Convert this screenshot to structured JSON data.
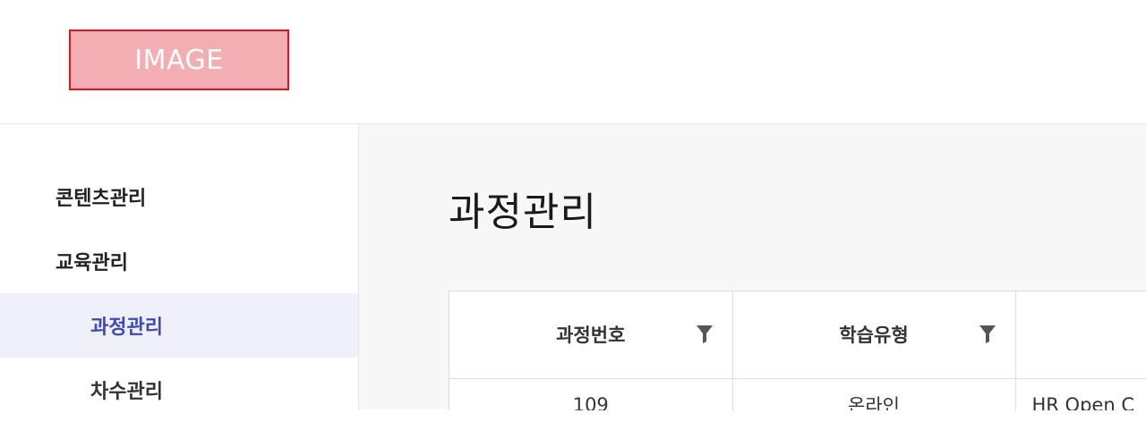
{
  "header": {
    "logo_text": "IMAGE"
  },
  "sidebar": {
    "items": [
      {
        "label": "콘텐츠관리",
        "type": "group"
      },
      {
        "label": "교육관리",
        "type": "group"
      },
      {
        "label": "과정관리",
        "type": "sub",
        "active": true
      },
      {
        "label": "차수관리",
        "type": "sub"
      }
    ]
  },
  "main": {
    "title": "과정관리",
    "table": {
      "columns": [
        {
          "label": "과정번호",
          "filter_icon": "filter-icon"
        },
        {
          "label": "학습유형",
          "filter_icon": "filter-icon"
        },
        {
          "label": ""
        }
      ],
      "rows": [
        [
          "109",
          "온라인",
          "HR Open C"
        ]
      ]
    }
  },
  "colors": {
    "accent": "#4048b5",
    "active_bg": "#eff0fa",
    "logo_bg": "#f2aeb2",
    "logo_border": "#e8101e"
  }
}
